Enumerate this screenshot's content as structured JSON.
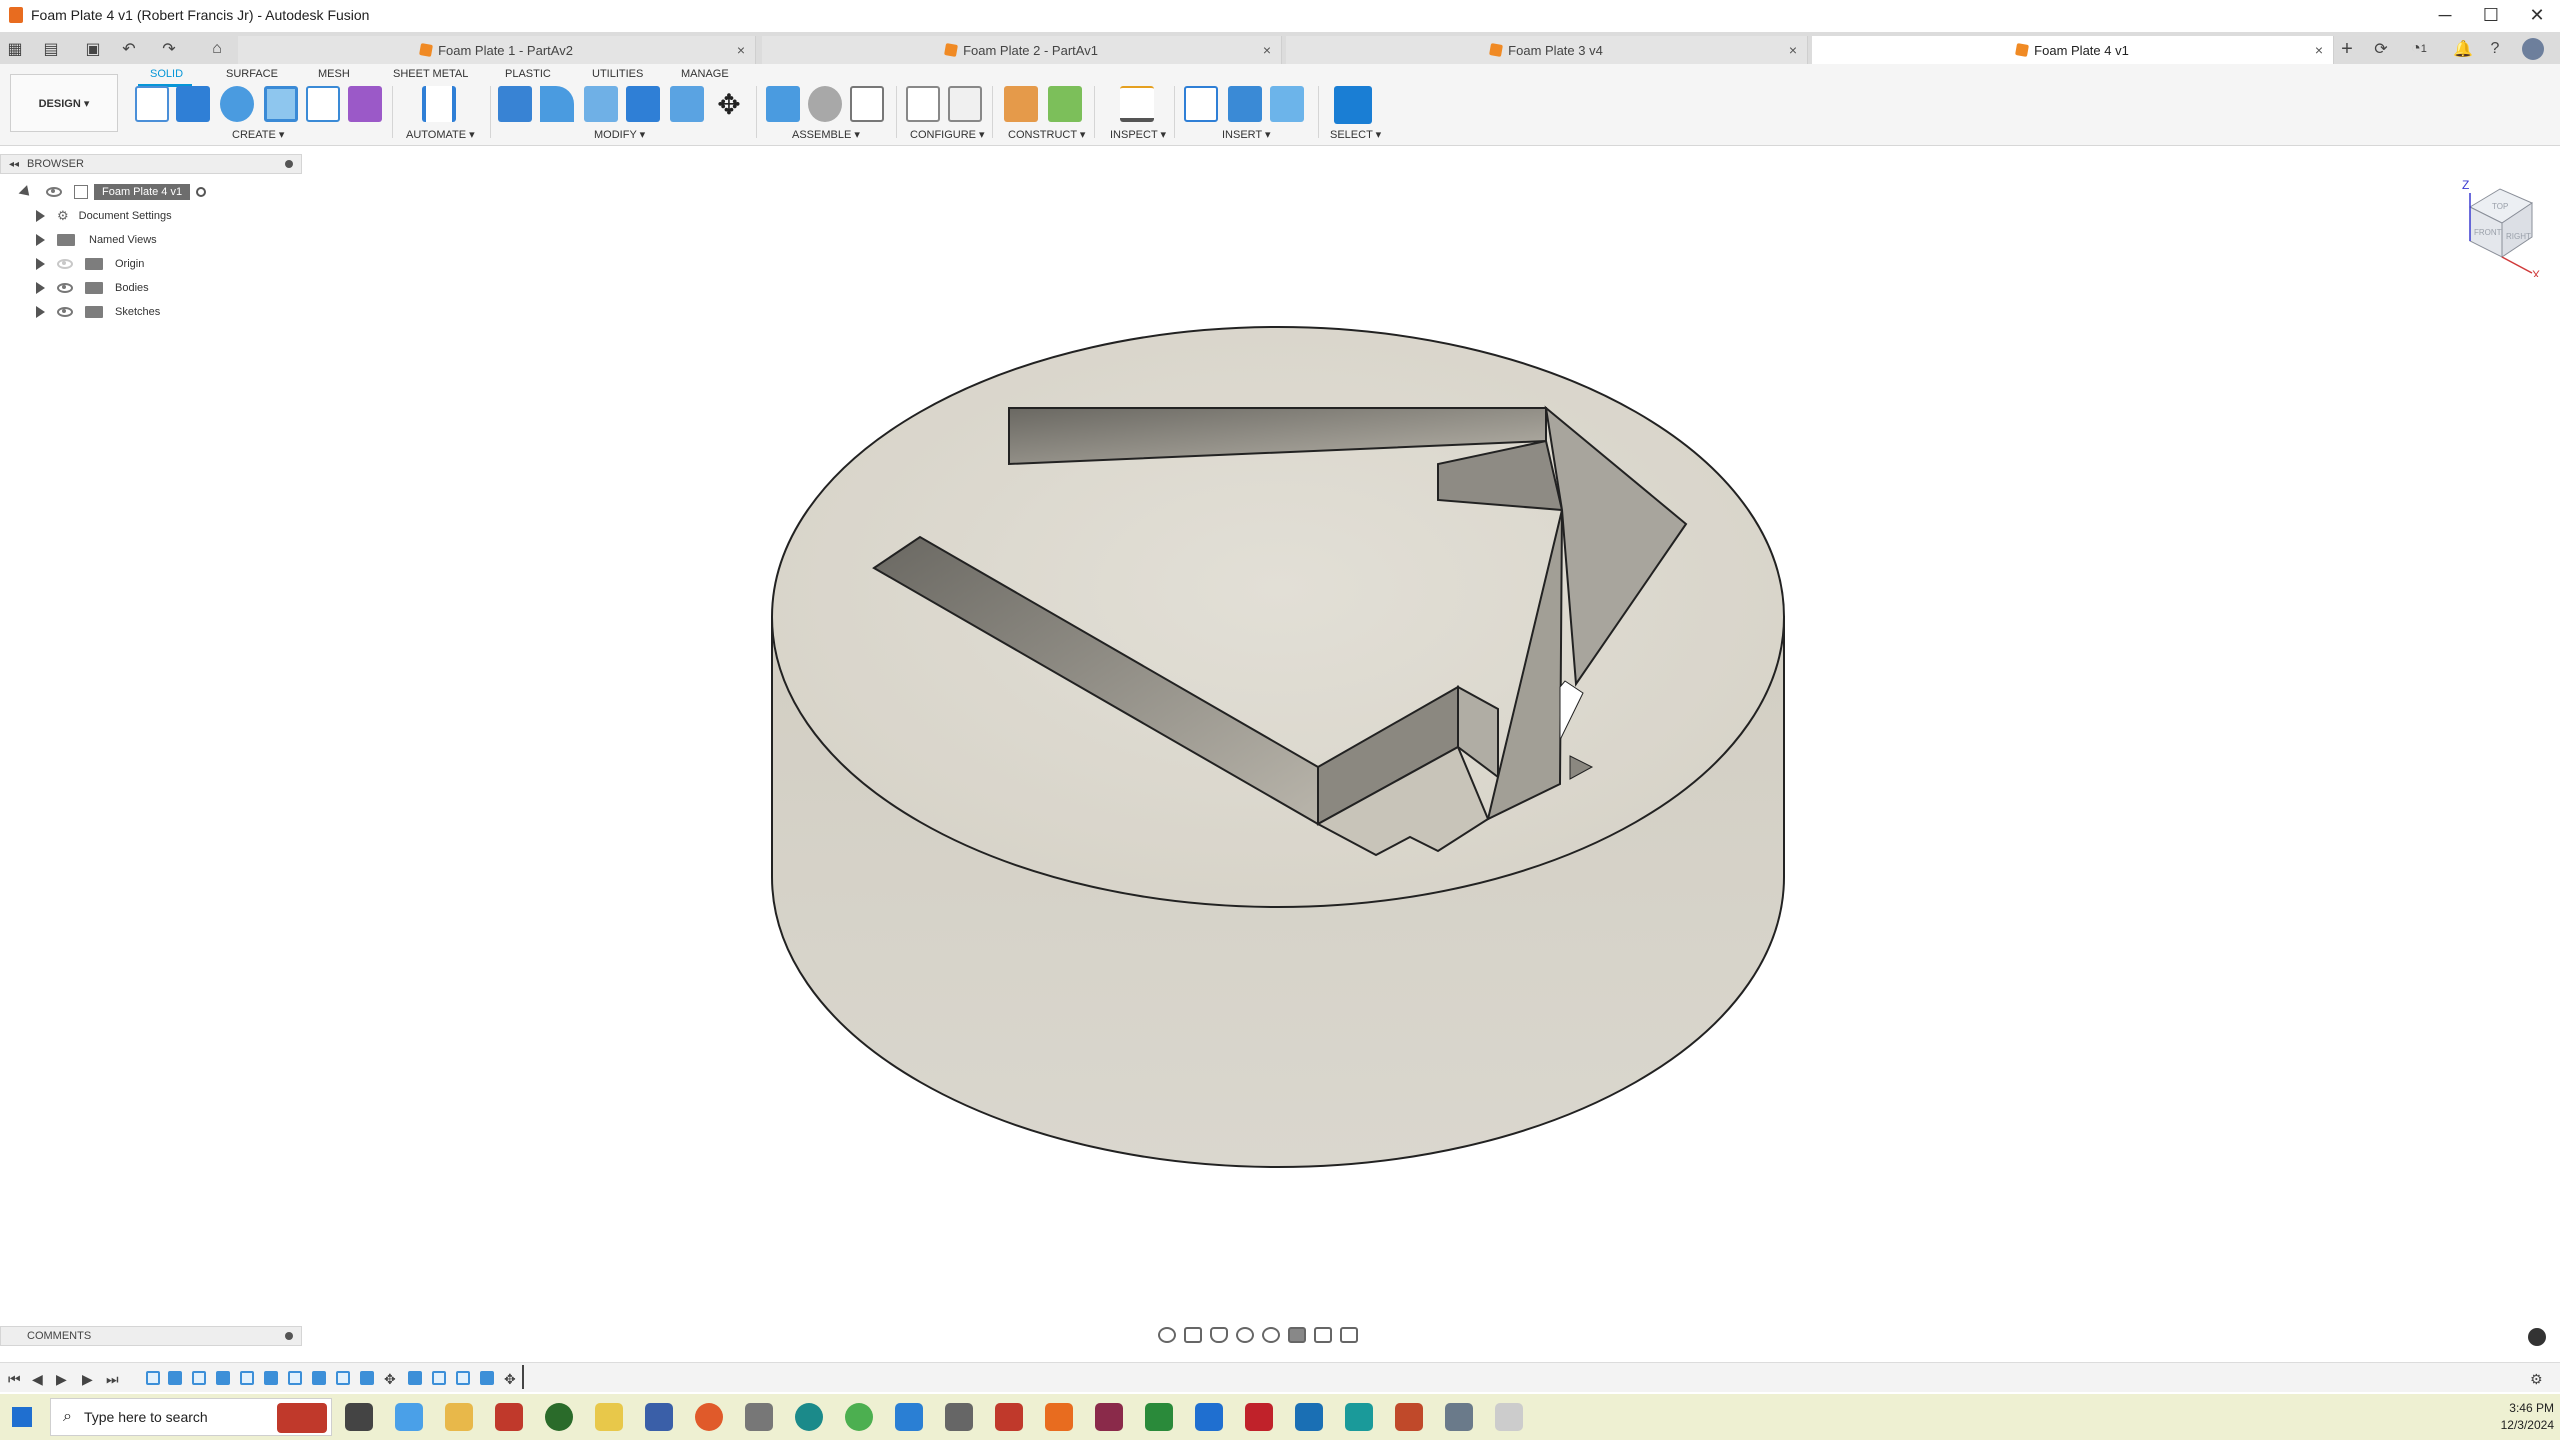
{
  "window": {
    "title": "Foam Plate 4 v1 (Robert Francis Jr) - Autodesk Fusion",
    "controls": {
      "minimize": "─",
      "maximize": "☐",
      "close": "✕"
    }
  },
  "tabs": [
    {
      "label": "Foam Plate 1 - PartAv2",
      "close": "×"
    },
    {
      "label": "Foam Plate 2 - PartAv1",
      "close": "×"
    },
    {
      "label": "Foam Plate 3 v4",
      "close": "×"
    },
    {
      "label": "Foam Plate 4 v1",
      "close": "×"
    }
  ],
  "tab_right": {
    "plus": "+",
    "job_count": "1"
  },
  "toolbar": {
    "workspace_label": "DESIGN ▾",
    "workspace_tabs": [
      "SOLID",
      "SURFACE",
      "MESH",
      "SHEET METAL",
      "PLASTIC",
      "UTILITIES",
      "MANAGE"
    ],
    "groups": {
      "create": "CREATE ▾",
      "automate": "AUTOMATE ▾",
      "modify": "MODIFY ▾",
      "assemble": "ASSEMBLE ▾",
      "configure": "CONFIGURE ▾",
      "construct": "CONSTRUCT ▾",
      "inspect": "INSPECT ▾",
      "insert": "INSERT ▾",
      "select": "SELECT ▾"
    }
  },
  "browser": {
    "header": "BROWSER",
    "root": "Foam Plate 4 v1",
    "items": [
      "Document Settings",
      "Named Views",
      "Origin",
      "Bodies",
      "Sketches"
    ]
  },
  "viewcube": {
    "axis_z": "Z",
    "axis_x": "X",
    "faces": [
      "TOP",
      "FRONT",
      "RIGHT"
    ]
  },
  "comments": {
    "header": "COMMENTS"
  },
  "taskbar": {
    "search_placeholder": "Type here to search",
    "time": "3:46 PM",
    "date": "12/3/2024"
  },
  "colors": {
    "accent": "#0696d7",
    "foam": "#dcd9d0",
    "foam_dark": "#c4c0b5",
    "taskbar": "#eef0d2"
  }
}
